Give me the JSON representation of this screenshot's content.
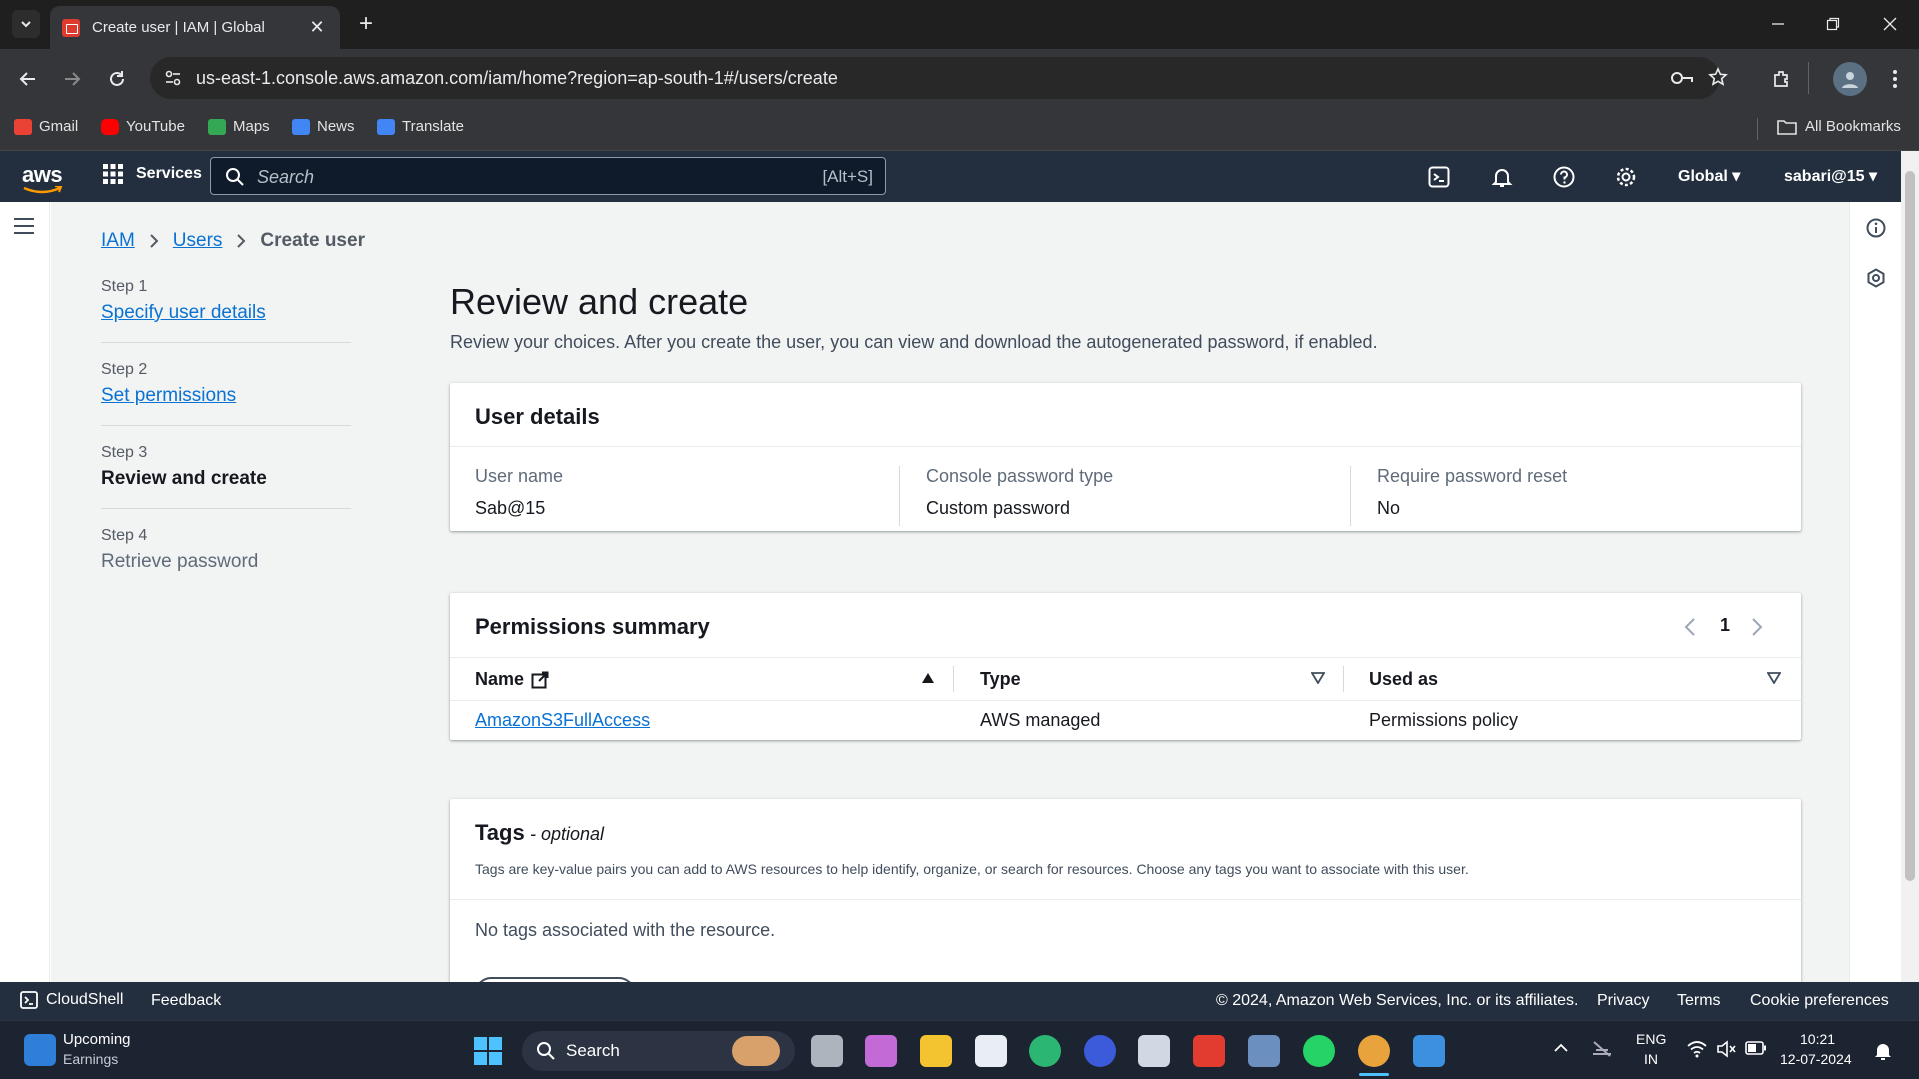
{
  "browser": {
    "tab_title": "Create user | IAM | Global",
    "url": "us-east-1.console.aws.amazon.com/iam/home?region=ap-south-1#/users/create",
    "bookmarks": [
      {
        "label": "Gmail",
        "icon": "gmail-icon",
        "color": "#ea4335"
      },
      {
        "label": "YouTube",
        "icon": "youtube-icon",
        "color": "#ff0000"
      },
      {
        "label": "Maps",
        "icon": "maps-icon",
        "color": "#34a853"
      },
      {
        "label": "News",
        "icon": "news-icon",
        "color": "#4285f4"
      },
      {
        "label": "Translate",
        "icon": "translate-icon",
        "color": "#4285f4"
      }
    ],
    "all_bookmarks": "All Bookmarks"
  },
  "aws_header": {
    "logo": "aws",
    "services": "Services",
    "search_placeholder": "Search",
    "search_shortcut": "[Alt+S]",
    "region": "Global",
    "account": "sabari@15"
  },
  "breadcrumb": {
    "items": [
      "IAM",
      "Users"
    ],
    "current": "Create user"
  },
  "steps": [
    {
      "num": "Step 1",
      "label": "Specify user details",
      "state": "link"
    },
    {
      "num": "Step 2",
      "label": "Set permissions",
      "state": "link"
    },
    {
      "num": "Step 3",
      "label": "Review and create",
      "state": "current"
    },
    {
      "num": "Step 4",
      "label": "Retrieve password",
      "state": "disabled"
    }
  ],
  "page": {
    "title": "Review and create",
    "description": "Review your choices. After you create the user, you can view and download the autogenerated password, if enabled."
  },
  "user_details": {
    "heading": "User details",
    "fields": [
      {
        "label": "User name",
        "value": "Sab@15"
      },
      {
        "label": "Console password type",
        "value": "Custom password"
      },
      {
        "label": "Require password reset",
        "value": "No"
      }
    ]
  },
  "permissions": {
    "heading": "Permissions summary",
    "page": "1",
    "columns": [
      "Name",
      "Type",
      "Used as"
    ],
    "rows": [
      {
        "name": "AmazonS3FullAccess",
        "type": "AWS managed",
        "used_as": "Permissions policy"
      }
    ]
  },
  "tags": {
    "heading": "Tags",
    "optional": "- optional",
    "description": "Tags are key-value pairs you can add to AWS resources to help identify, organize, or search for resources. Choose any tags you want to associate with this user.",
    "empty": "No tags associated with the resource."
  },
  "footer": {
    "cloudshell": "CloudShell",
    "feedback": "Feedback",
    "copyright": "© 2024, Amazon Web Services, Inc. or its affiliates.",
    "privacy": "Privacy",
    "terms": "Terms",
    "cookies": "Cookie preferences"
  },
  "taskbar": {
    "widget_title": "Upcoming",
    "widget_sub": "Earnings",
    "search": "Search",
    "lang1": "ENG",
    "lang2": "IN",
    "time": "10:21",
    "date": "12-07-2024"
  },
  "colors": {
    "aws_nav": "#232f3e",
    "link": "#0972d3",
    "page_bg": "#f2f3f3"
  }
}
